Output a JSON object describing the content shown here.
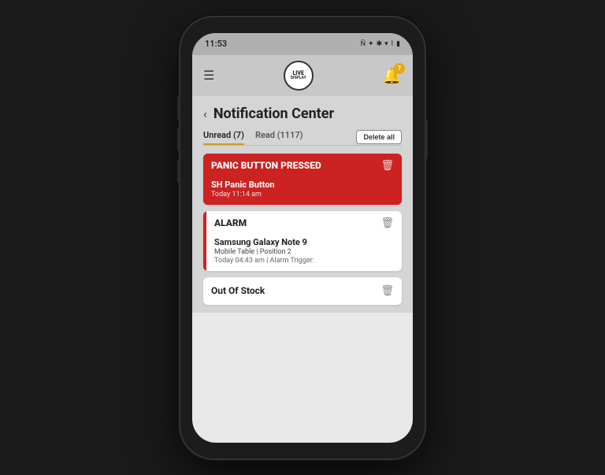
{
  "phone": {
    "status_bar": {
      "time": "11:53",
      "icons": [
        "N",
        "★",
        "((•))",
        "WiFi",
        "Battery"
      ]
    },
    "top_bar": {
      "menu_label": "☰",
      "logo_line1": "LIVE",
      "logo_line2": "DISPLAY",
      "bell_badge": "7"
    },
    "notification_center": {
      "back_label": "‹",
      "title": "Notification Center",
      "tabs": {
        "unread_label": "Unread (7)",
        "read_label": "Read (1117)",
        "delete_button_label": "Delete all"
      },
      "notifications": [
        {
          "id": "panic",
          "type": "PANIC BUTTON PRESSED",
          "name": "SH Panic Button",
          "time": "Today 11:14 am",
          "style": "panic"
        },
        {
          "id": "alarm",
          "type": "ALARM",
          "name": "Samsung Galaxy Note 9",
          "sub": "Mobile Table | Position 2",
          "time": "Today 04:43 am | Alarm Trigger:",
          "style": "alarm"
        },
        {
          "id": "out-of-stock",
          "type": "Out Of Stock",
          "style": "oos"
        }
      ]
    }
  }
}
